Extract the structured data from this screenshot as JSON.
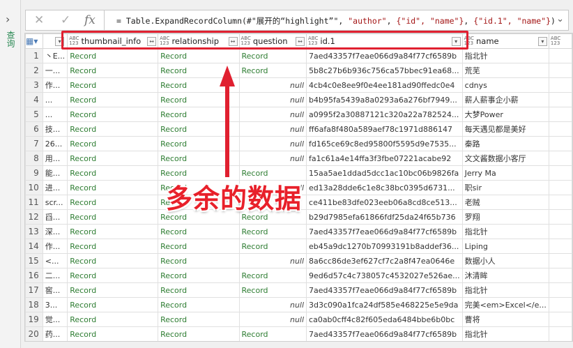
{
  "sidebar": {
    "label": "查询"
  },
  "formula_bar": {
    "prefix": "= Table.ExpandRecordColumn(#\"展开的“highlight”\", ",
    "arg1": "\"author\"",
    ", ": ", ",
    "arg2": "{\"id\", \"name\"}",
    "arg3": "{\"id.1\", \"name\"}",
    "close": ")"
  },
  "type_badge": "ABC 123",
  "columns": [
    "thumbnail_info",
    "relationship",
    "question",
    "id.1",
    "name"
  ],
  "annotation": "多余的数据",
  "null_label": "null",
  "rows": [
    {
      "n": "1",
      "c0": "丶E...",
      "t": "Record",
      "r": "Record",
      "q": "Record",
      "id": "7aed43357f7eae066d9a84f77cf6589b",
      "name": "指北针"
    },
    {
      "n": "2",
      "c0": "一...",
      "t": "Record",
      "r": "Record",
      "q": "Record",
      "id": "5b8c27b6b936c756ca57bbec91ea68...",
      "name": "荒芜"
    },
    {
      "n": "3",
      "c0": "作...",
      "t": "Record",
      "r": "Record",
      "q": "null",
      "id": "4cb4c0e8ee9f0e4ee181ad90ffedc0e4",
      "name": "cdnys"
    },
    {
      "n": "4",
      "c0": "...",
      "t": "Record",
      "r": "Record",
      "q": "null",
      "id": "b4b95fa5439a8a0293a6a276bf7949...",
      "name": "薪人薪事企小薪"
    },
    {
      "n": "5",
      "c0": "...",
      "t": "Record",
      "r": "Record",
      "q": "null",
      "id": "a0995f2a30887121c320a22a782524...",
      "name": "大梦Power"
    },
    {
      "n": "6",
      "c0": "技...",
      "t": "Record",
      "r": "Record",
      "q": "null",
      "id": "ff6afa8f480a589aef78c1971d886147",
      "name": "每天遇见都是美好"
    },
    {
      "n": "7",
      "c0": "26...",
      "t": "Record",
      "r": "Record",
      "q": "null",
      "id": "fd165ce69c8ed95800f5595d9e7535...",
      "name": "秦路"
    },
    {
      "n": "8",
      "c0": "用...",
      "t": "Record",
      "r": "Record",
      "q": "null",
      "id": "fa1c61a4e14ffa3f3fbe07221acabe92",
      "name": "文文酱数据小客厅"
    },
    {
      "n": "9",
      "c0": "能...",
      "t": "Record",
      "r": "Record",
      "q": "Record",
      "id": "15aa5ae1ddad5dcc1ac10bc06b9826fa",
      "name": "Jerry Ma"
    },
    {
      "n": "10",
      "c0": "进...",
      "t": "Record",
      "r": "Record",
      "q": "null",
      "id": "ed13a28dde6c1e8c38bc0395d6731...",
      "name": "职sir"
    },
    {
      "n": "11",
      "c0": "scr...",
      "t": "Record",
      "r": "Record",
      "q": "",
      "id": "ce411be83dfe023eeb06a8cd8ce513...",
      "name": "老贼"
    },
    {
      "n": "12",
      "c0": "舀...",
      "t": "Record",
      "r": "Record",
      "q": "Record",
      "id": "b29d7985efa61866fdf25da24f65b736",
      "name": "罗翔"
    },
    {
      "n": "13",
      "c0": "深...",
      "t": "Record",
      "r": "Record",
      "q": "Record",
      "id": "7aed43357f7eae066d9a84f77cf6589b",
      "name": "指北针"
    },
    {
      "n": "14",
      "c0": "作...",
      "t": "Record",
      "r": "Record",
      "q": "Record",
      "id": "eb45a9dc1270b70993191b8addef36...",
      "name": "Liping"
    },
    {
      "n": "15",
      "c0": "<...",
      "t": "Record",
      "r": "Record",
      "q": "null",
      "id": "8a6cc86de3ef627cf7c2a8f47ea0646e",
      "name": "数据小人"
    },
    {
      "n": "16",
      "c0": "二...",
      "t": "Record",
      "r": "Record",
      "q": "Record",
      "id": "9ed6d57c4c738057c4532027e526ae...",
      "name": "沐清眸"
    },
    {
      "n": "17",
      "c0": "窖...",
      "t": "Record",
      "r": "Record",
      "q": "Record",
      "id": "7aed43357f7eae066d9a84f77cf6589b",
      "name": "指北针"
    },
    {
      "n": "18",
      "c0": "3...",
      "t": "Record",
      "r": "Record",
      "q": "null",
      "id": "3d3c090a1fca24df585e468225e5e9da",
      "name": "完美<em>Excel</e..."
    },
    {
      "n": "19",
      "c0": "觉...",
      "t": "Record",
      "r": "Record",
      "q": "null",
      "id": "ca0ab0cff4c82f605eda6484bbe6b0bc",
      "name": "曹将"
    },
    {
      "n": "20",
      "c0": "药...",
      "t": "Record",
      "r": "Record",
      "q": "Record",
      "id": "7aed43357f7eae066d9a84f77cf6589b",
      "name": "指北针"
    }
  ]
}
